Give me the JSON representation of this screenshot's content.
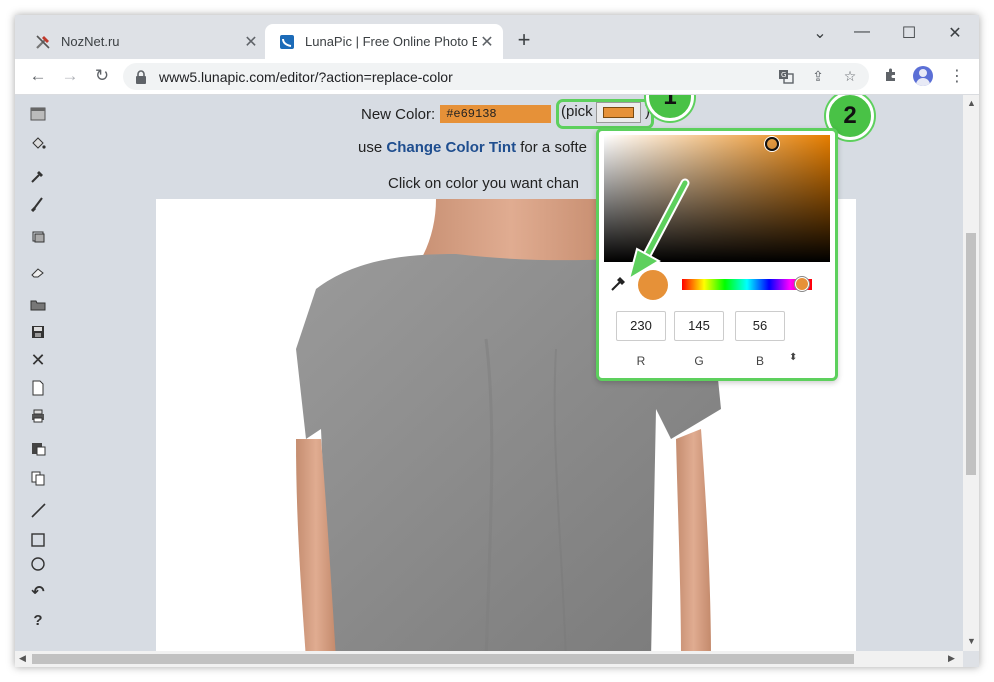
{
  "tabs": [
    {
      "title": "NozNet.ru",
      "icon": "tools-icon"
    },
    {
      "title": "LunaPic | Free Online Photo Editor",
      "icon": "lunapic-icon"
    }
  ],
  "new_tab_label": "+",
  "window_controls": {
    "chevron": "⌄",
    "minimize": "—",
    "maximize": "☐",
    "close": "✕"
  },
  "address_bar": {
    "url": "www5.lunapic.com/editor/?action=replace-color"
  },
  "editor": {
    "new_color_label": "New Color:",
    "new_color_value": "#e69138",
    "pick_open": "(pick",
    "pick_close": ")",
    "tint_prefix": "use ",
    "tint_link": "Change Color Tint",
    "tint_suffix": " for a softe",
    "click_text": "Click on color you want chan"
  },
  "annotations": {
    "badge1": "1",
    "badge2": "2"
  },
  "color_picker": {
    "r": "230",
    "g": "145",
    "b": "56",
    "r_label": "R",
    "g_label": "G",
    "b_label": "B",
    "spin": "⬍",
    "current_color": "#e69138"
  },
  "sidebar_tools": [
    "layers-icon",
    "paint-bucket-icon",
    "eyedropper-icon",
    "brush-icon",
    "crop-icon",
    "eraser-icon",
    "open-folder-icon",
    "save-icon",
    "close-icon",
    "new-file-icon",
    "print-icon",
    "paste-icon",
    "copy-icon",
    "line-icon",
    "rectangle-icon",
    "circle-icon",
    "undo-icon",
    "help-icon"
  ],
  "colors": {
    "accent_green": "#5dd05d",
    "picked_orange": "#e69138",
    "link_blue": "#1f4e8f"
  }
}
